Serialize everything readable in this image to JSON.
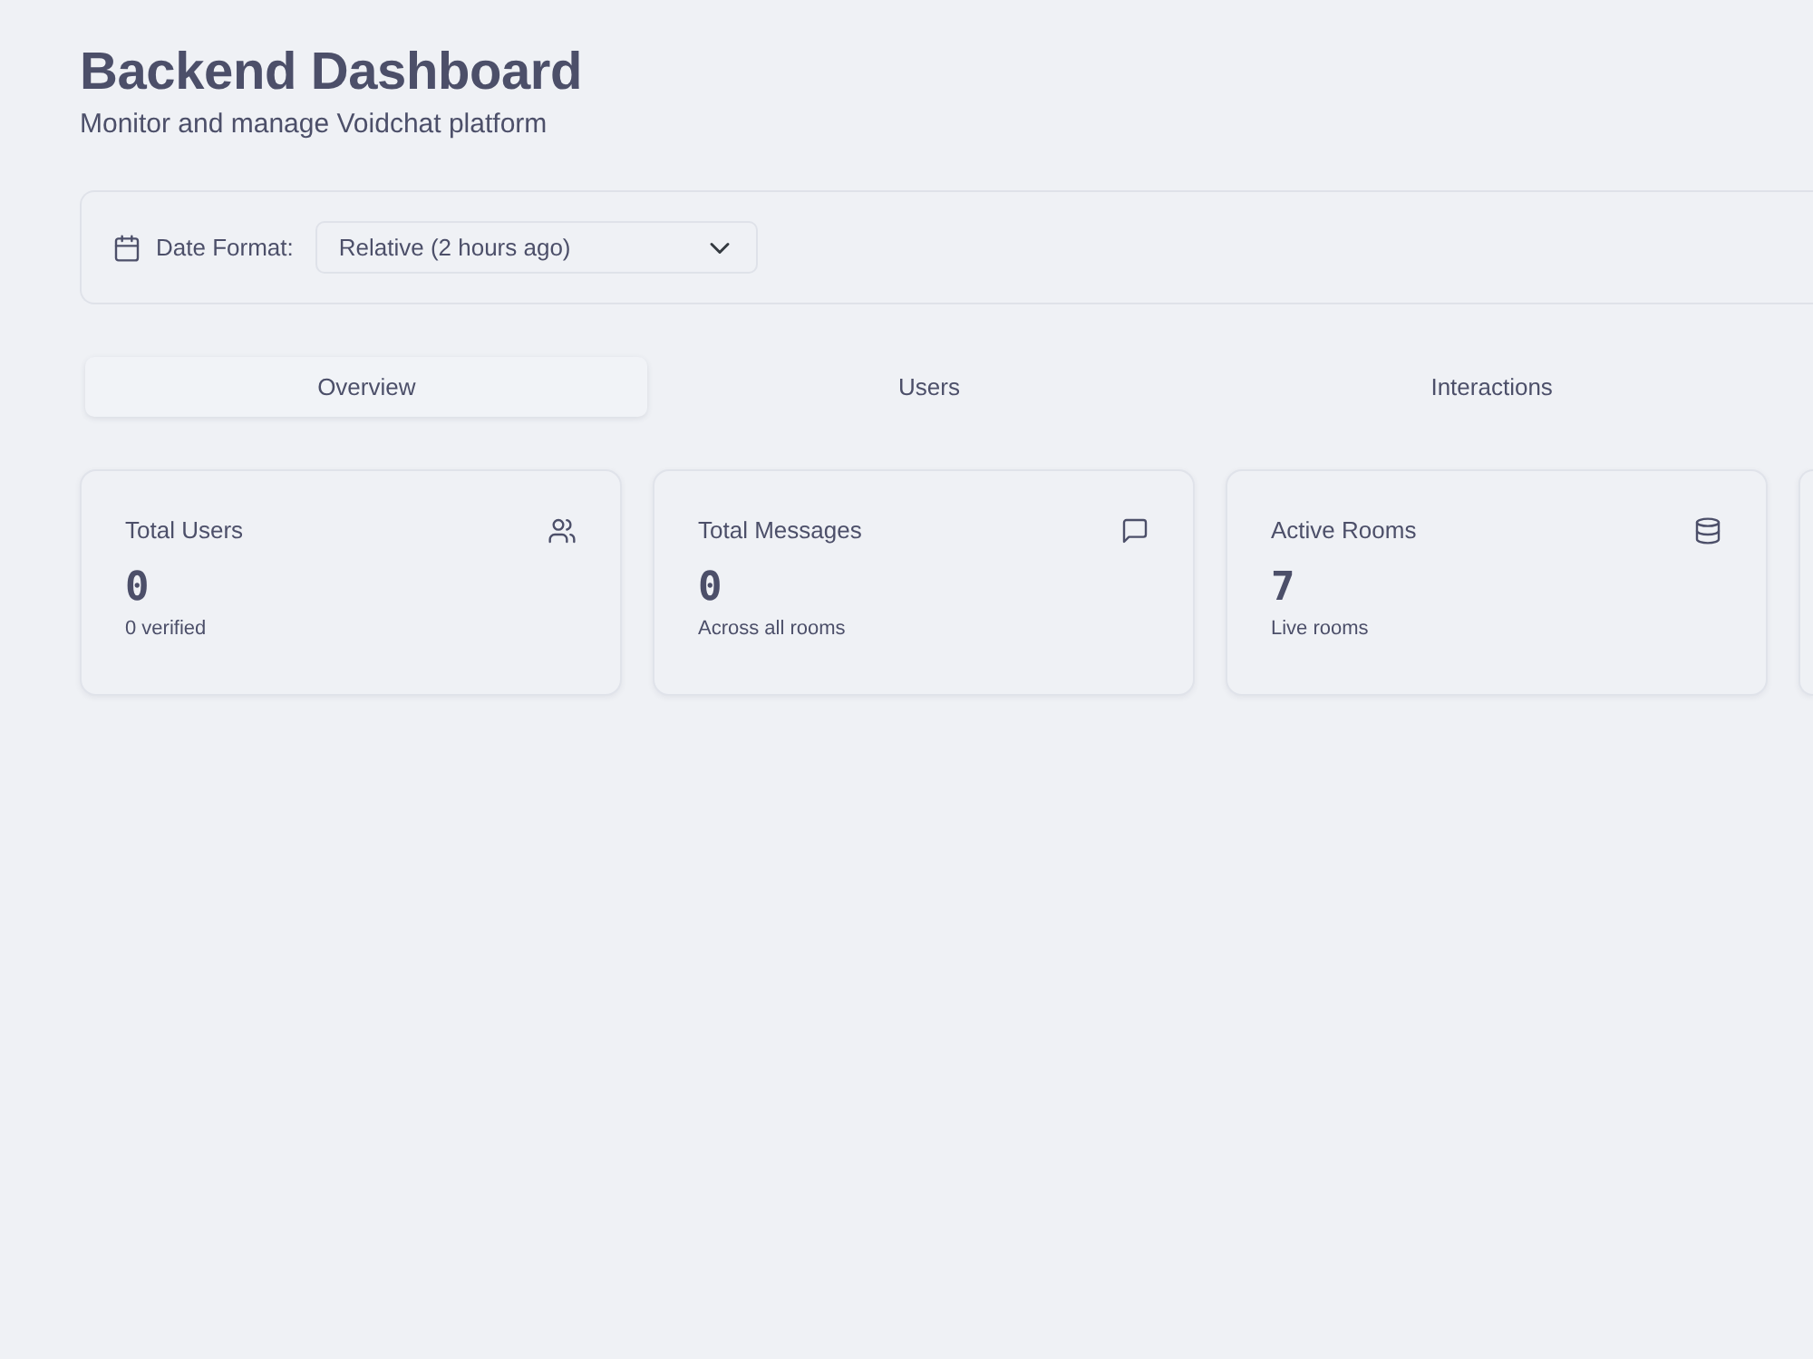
{
  "header": {
    "title": "Backend Dashboard",
    "subtitle": "Monitor and manage Voidchat platform"
  },
  "filter": {
    "label": "Date Format:",
    "value": "Relative (2 hours ago)"
  },
  "tabs": [
    {
      "label": "Overview",
      "selected": true
    },
    {
      "label": "Users",
      "selected": false
    },
    {
      "label": "Interactions",
      "selected": false
    }
  ],
  "stat_cards": [
    {
      "kind": "users",
      "title": "Total Users",
      "value": "0",
      "note": "0 verified"
    },
    {
      "kind": "messages",
      "title": "Total Messages",
      "value": "0",
      "note": "Across all rooms"
    },
    {
      "kind": "rooms",
      "title": "Active Rooms",
      "value": "7",
      "note": "Live rooms"
    },
    {
      "kind": "clipped"
    }
  ]
}
